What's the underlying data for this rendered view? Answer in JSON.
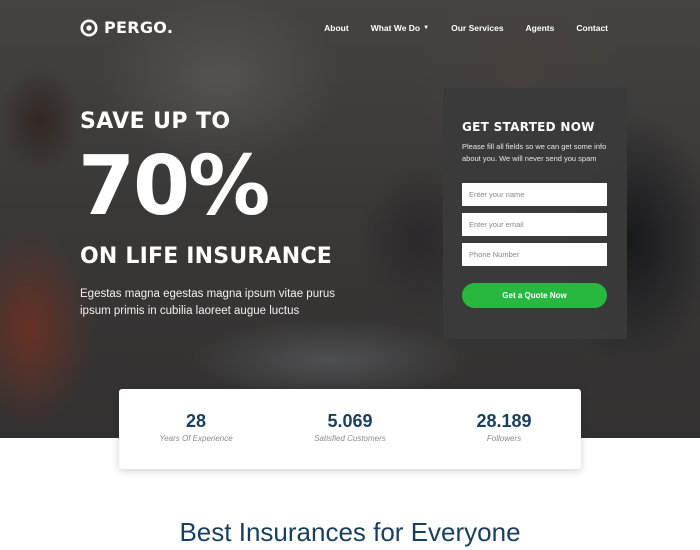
{
  "brand": {
    "name": "PERGO."
  },
  "nav": {
    "items": [
      {
        "label": "About"
      },
      {
        "label": "What We Do",
        "dropdown": true
      },
      {
        "label": "Our Services"
      },
      {
        "label": "Agents"
      },
      {
        "label": "Contact"
      }
    ]
  },
  "hero": {
    "line1": "SAVE UP TO",
    "big": "70%",
    "line3": "ON LIFE INSURANCE",
    "subtitle": "Egestas magna egestas magna ipsum vitae purus ipsum primis in cubilia laoreet augue luctus"
  },
  "form": {
    "title": "GET STARTED NOW",
    "description": "Please fill all fields so we can get some info about you. We will never send you spam",
    "name_placeholder": "Enter your name",
    "email_placeholder": "Enter your email",
    "phone_placeholder": "Phone Number",
    "name_value": "",
    "email_value": "",
    "phone_value": "",
    "button_label": "Get a Quote Now"
  },
  "stats": [
    {
      "value": "28",
      "label": "Years Of Experience"
    },
    {
      "value": "5.069",
      "label": "Satisfied Customers"
    },
    {
      "value": "28.189",
      "label": "Followers"
    }
  ],
  "section": {
    "title": "Best Insurances for Everyone"
  },
  "colors": {
    "accent_green": "#28b840",
    "heading_navy": "#1a3e5e",
    "form_bg": "#3a3a3a"
  },
  "icons": {
    "logo": "pergo-circle-logo-icon",
    "dropdown": "chevron-down-icon"
  }
}
